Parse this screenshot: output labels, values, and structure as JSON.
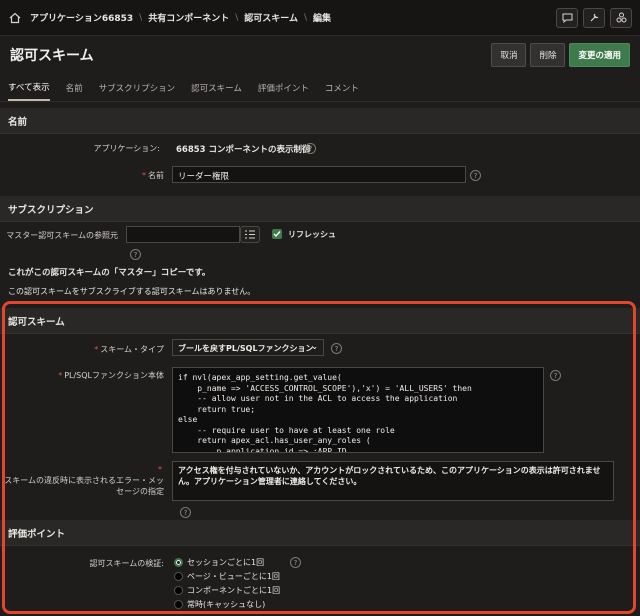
{
  "breadcrumb": [
    "アプリケーション66853",
    "共有コンポーネント",
    "認可スキーム",
    "編集"
  ],
  "page_title": "認可スキーム",
  "actions": {
    "cancel": "取消",
    "delete": "削除",
    "apply": "変更の適用"
  },
  "tabs": [
    "すべて表示",
    "名前",
    "サブスクリプション",
    "認可スキーム",
    "評価ポイント",
    "コメント"
  ],
  "sections": {
    "name": {
      "title": "名前",
      "app_label": "アプリケーション:",
      "app_value": "66853 コンポーネントの表示制御",
      "name_label": "名前",
      "name_value": "リーダー権限"
    },
    "subscription": {
      "title": "サブスクリプション",
      "ref_label": "マスター認可スキームの参照元",
      "refresh_label": "リフレッシュ",
      "note1": "これがこの認可スキームの「マスター」コピーです。",
      "note2": "この認可スキームをサブスクライブする認可スキームはありません。"
    },
    "scheme": {
      "title": "認可スキーム",
      "type_label": "スキーム・タイプ",
      "type_value": "ブールを戻すPL/SQLファンクション",
      "body_label": "PL/SQLファンクション本体",
      "body_value": "if nvl(apex_app_setting.get_value(\n    p_name => 'ACCESS_CONTROL_SCOPE'),'x') = 'ALL_USERS' then\n    -- allow user not in the ACL to access the application\n    return true;\nelse\n    -- require user to have at least one role\n    return apex_acl.has_user_any_roles (\n        p_application_id => :APP_ID,",
      "error_label": "スキームの違反時に表示されるエラー・メッセージの指定",
      "error_value": "アクセス権を付与されていないか、アカウントがロックされているため、このアプリケーションの表示は許可されません。アプリケーション管理者に連絡してください。"
    },
    "evaluation": {
      "title": "評価ポイント",
      "validate_label": "認可スキームの検証:",
      "options": [
        "セッションごとに1回",
        "ページ・ビューごとに1回",
        "コンポーネントごとに1回",
        "常時(キャッシュなし)"
      ],
      "selected": 0
    }
  },
  "colors": {
    "accent": "#3f7a4d",
    "highlight": "#e2462d",
    "required": "#d4574b"
  }
}
